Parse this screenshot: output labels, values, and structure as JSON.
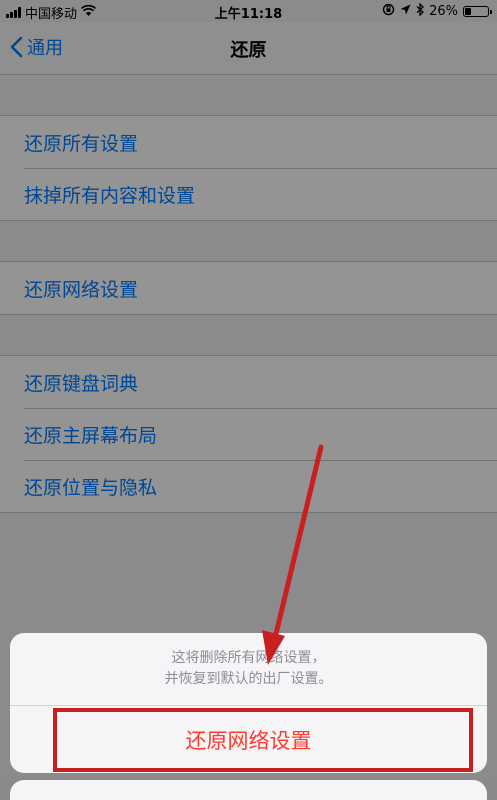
{
  "status_bar": {
    "carrier": "中国移动",
    "time": "上午11:18",
    "battery_percent": "26%",
    "battery_level": 0.26,
    "icons": [
      "signal-icon",
      "wifi-icon",
      "orientation-lock-icon",
      "location-icon",
      "bluetooth-icon",
      "battery-icon"
    ]
  },
  "nav": {
    "back_label": "通用",
    "title": "还原"
  },
  "groups": [
    {
      "items": [
        {
          "label": "还原所有设置"
        },
        {
          "label": "抹掉所有内容和设置"
        }
      ]
    },
    {
      "items": [
        {
          "label": "还原网络设置"
        }
      ]
    },
    {
      "items": [
        {
          "label": "还原键盘词典"
        },
        {
          "label": "还原主屏幕布局"
        },
        {
          "label": "还原位置与隐私"
        }
      ]
    }
  ],
  "action_sheet": {
    "message_line1": "这将删除所有网络设置，",
    "message_line2": "并恢复到默认的出厂设置。",
    "action_label": "还原网络设置"
  },
  "colors": {
    "accent": "#007aff",
    "destructive": "#ff3b30",
    "annotation": "#c8201e"
  }
}
